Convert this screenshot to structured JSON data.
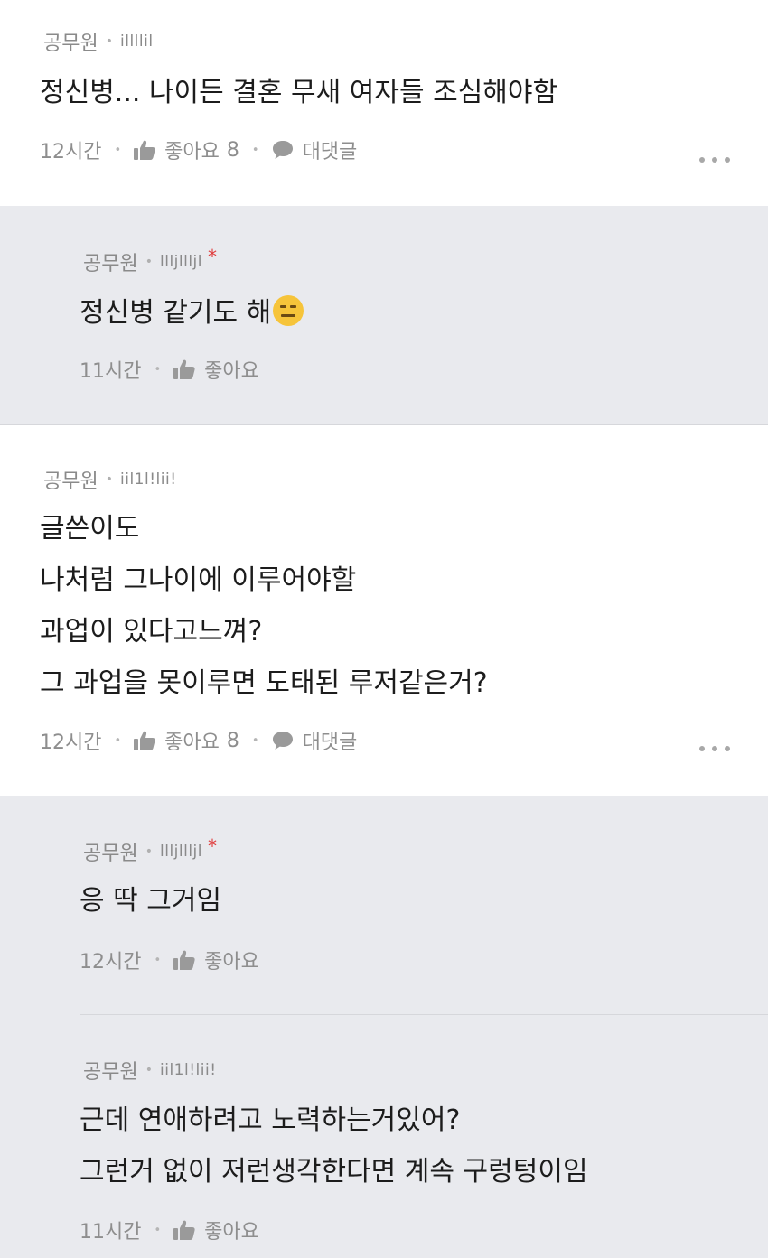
{
  "comments": [
    {
      "author": "공무원",
      "uid": "illllil",
      "lines": [
        "정신병... 나이든 결혼 무새 여자들 조심해야함"
      ],
      "time": "12시간",
      "like_label": "좋아요",
      "like_count": "8",
      "reply_label": "대댓글"
    },
    {
      "author": "공무원",
      "uid": "llljllljl",
      "lines": [
        "정신병 같기도 해"
      ],
      "time": "11시간",
      "like_label": "좋아요"
    },
    {
      "author": "공무원",
      "uid": "iil1l!lii!",
      "lines": [
        "글쓴이도",
        "나처럼 그나이에 이루어야할",
        "과업이 있다고느껴?",
        "그 과업을 못이루면 도태된 루저같은거?"
      ],
      "time": "12시간",
      "like_label": "좋아요",
      "like_count": "8",
      "reply_label": "대댓글"
    },
    {
      "author": "공무원",
      "uid": "llljllljl",
      "lines": [
        "응 딱 그거임"
      ],
      "time": "12시간",
      "like_label": "좋아요"
    },
    {
      "author": "공무원",
      "uid": "iil1l!lii!",
      "lines": [
        "근데 연애하려고 노력하는거있어?",
        "그런거 없이 저런생각한다면 계속 구렁텅이임"
      ],
      "time": "11시간",
      "like_label": "좋아요"
    }
  ],
  "icons": {
    "like": "thumbs-up-icon",
    "reply": "speech-bubble-icon",
    "more": "more-dots-icon",
    "emoji": "expressionless-face-emoji"
  },
  "colors": {
    "reply_background": "#e9eaee",
    "author_star": "#e03b3b"
  }
}
